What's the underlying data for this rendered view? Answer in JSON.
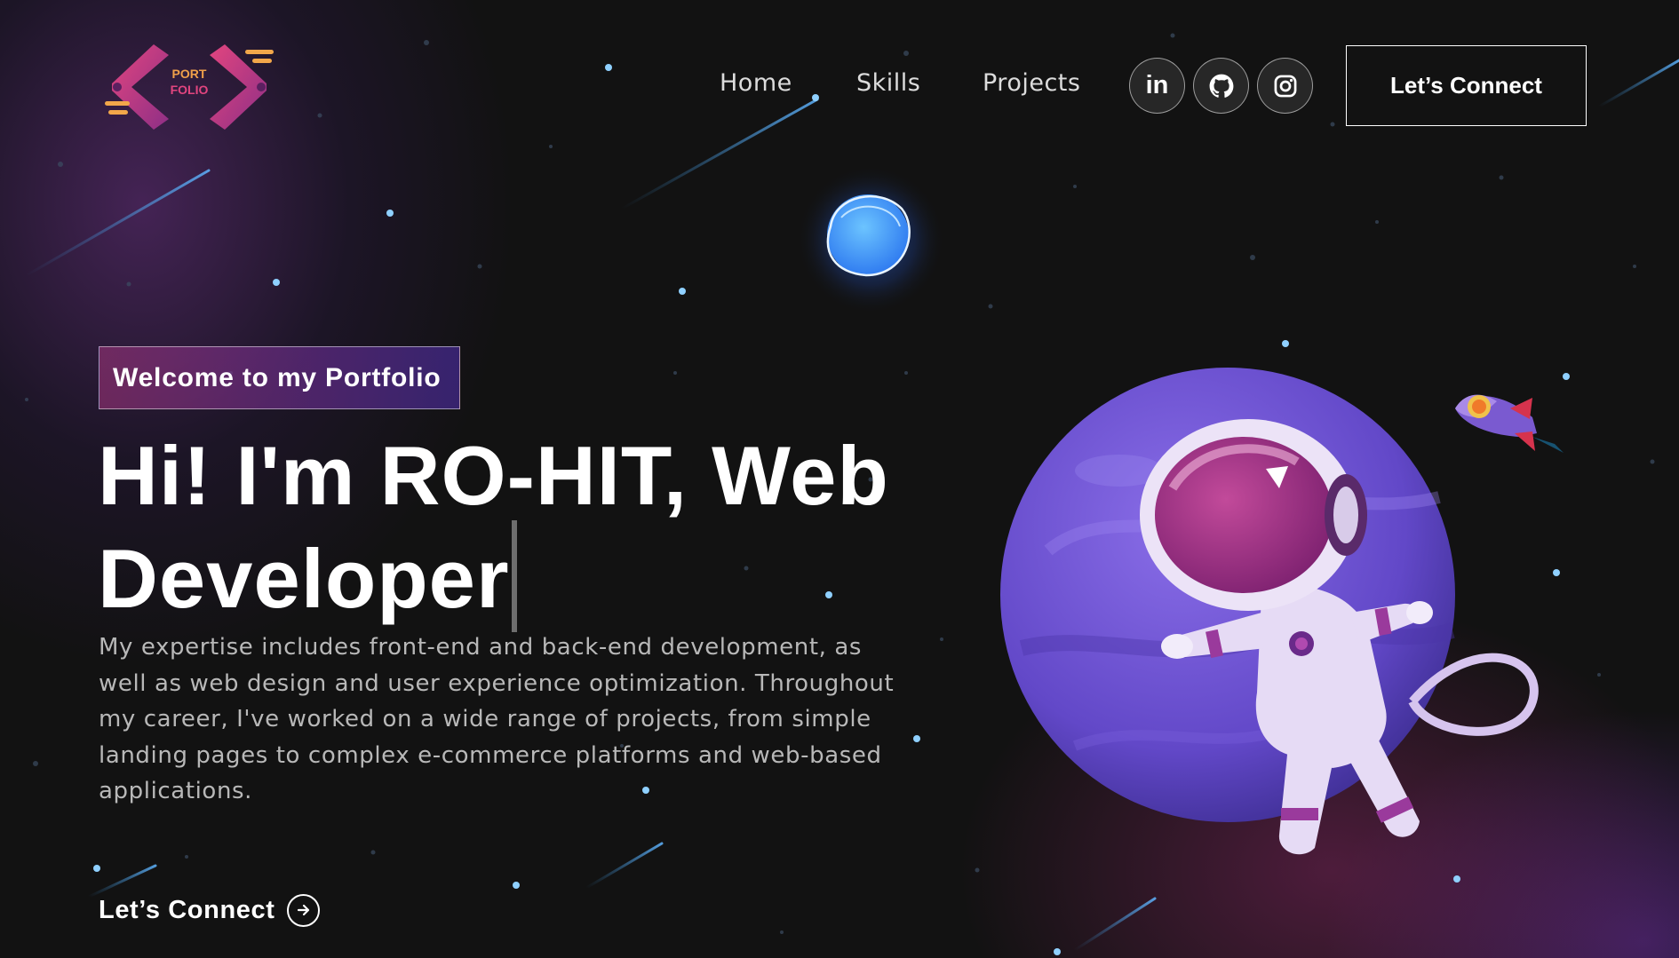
{
  "logo": {
    "line1": "PORT",
    "line2": "FOLIO",
    "icon": "code-brackets-logo"
  },
  "nav": {
    "links": [
      "Home",
      "Skills",
      "Projects"
    ],
    "social": [
      {
        "icon": "linkedin-icon",
        "label": "in"
      },
      {
        "icon": "github-icon"
      },
      {
        "icon": "instagram-icon"
      }
    ],
    "connect_label": "Let’s Connect"
  },
  "hero": {
    "tagline": "Welcome to my Portfolio",
    "title_line1": "Hi! I'm RO-HIT, Web",
    "title_line2": "Developer",
    "description": "My expertise includes front-end and back-end development, as well as web design and user experience optimization. Throughout my career, I've worked on a wide range of projects, from simple landing pages to complex e-commerce platforms and web-based applications.",
    "cta_label": "Let’s Connect",
    "cta_icon": "arrow-right-circle-icon"
  },
  "colors": {
    "background": "#121212",
    "gradient_start": "#AA367C",
    "gradient_end": "#4A2FBD",
    "accent_blue": "#4aa8ff"
  }
}
